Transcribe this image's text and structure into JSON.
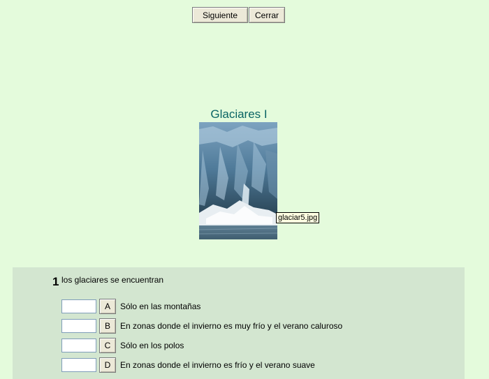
{
  "toolbar": {
    "next_label": "Siguiente",
    "close_label": "Cerrar"
  },
  "page": {
    "title": "Glaciares I"
  },
  "image": {
    "tooltip": "glaciar5.jpg"
  },
  "question": {
    "number": "1",
    "text": "los glaciares se encuentran",
    "options": [
      {
        "letter": "A",
        "text": "Sólo en las montañas",
        "value": ""
      },
      {
        "letter": "B",
        "text": "En zonas donde el invierno es muy frío y el verano caluroso",
        "value": ""
      },
      {
        "letter": "C",
        "text": "Sólo en los polos",
        "value": ""
      },
      {
        "letter": "D",
        "text": "En zonas donde el invierno es frío y el verano suave",
        "value": ""
      }
    ]
  },
  "colors": {
    "background": "#e4fbdc",
    "title": "#0a6464",
    "quiz_panel": "#d3e6d0"
  }
}
